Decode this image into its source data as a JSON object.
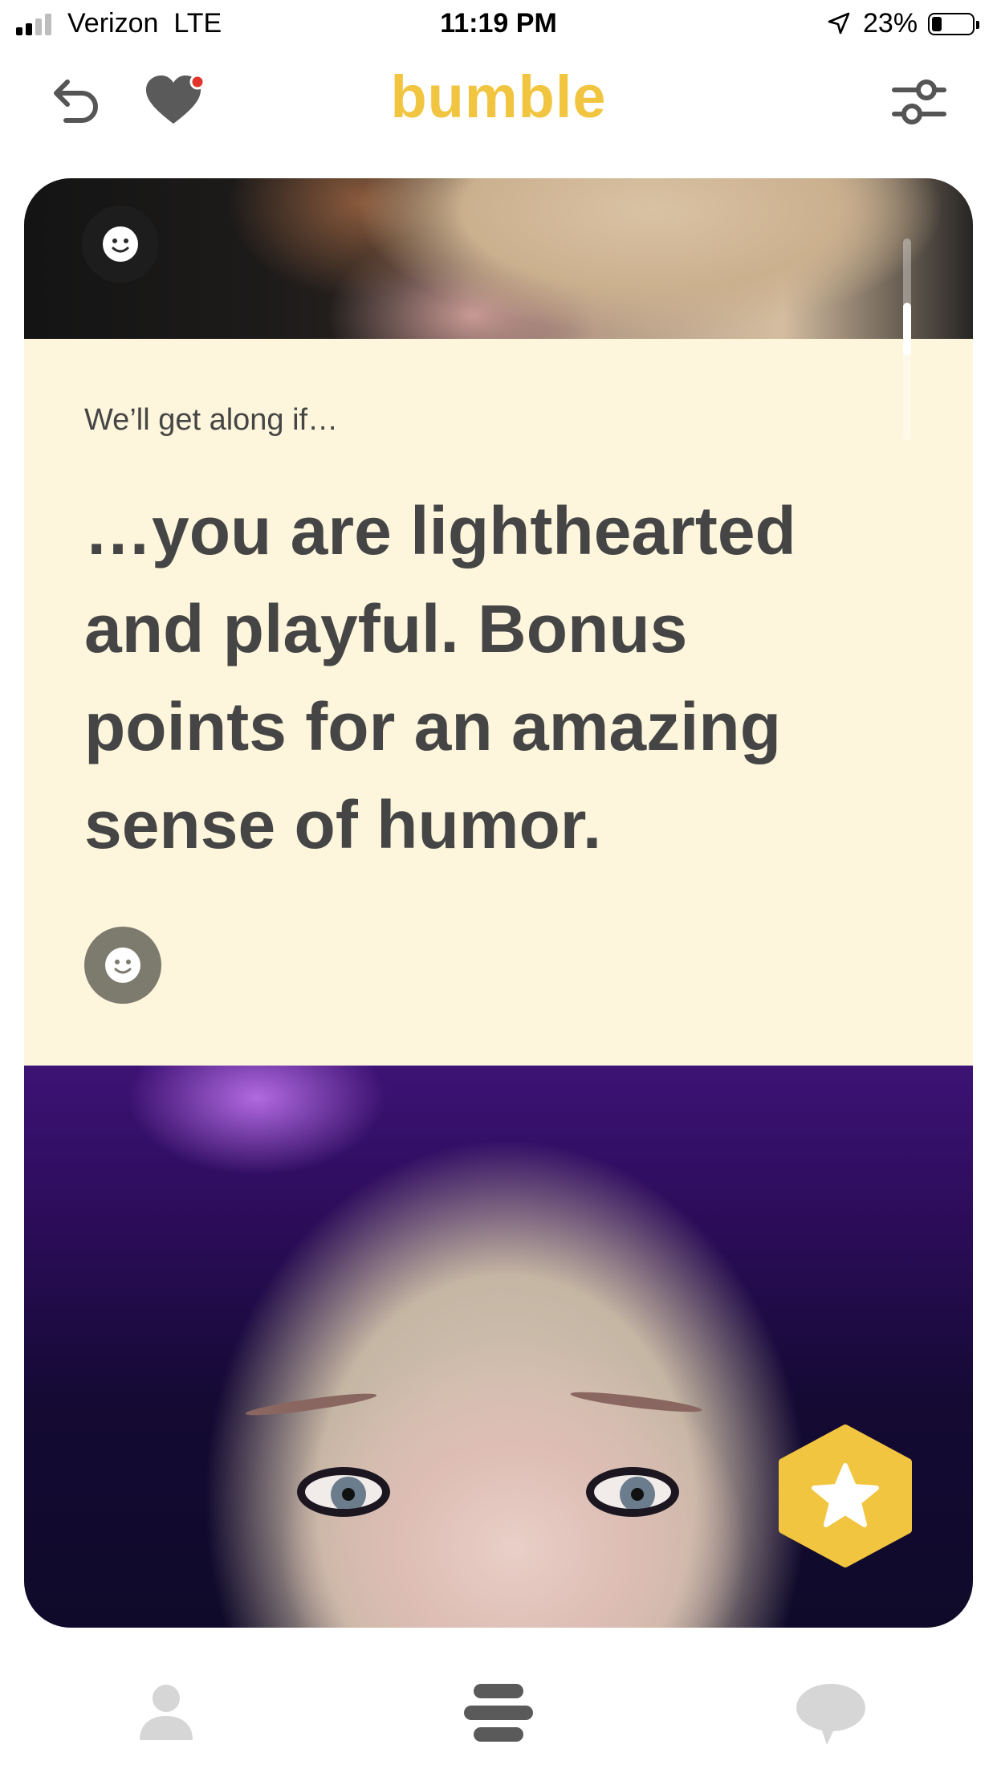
{
  "status_bar": {
    "carrier": "Verizon",
    "network": "LTE",
    "time": "11:19 PM",
    "battery": "23%"
  },
  "header": {
    "brand": "bumble",
    "back_icon": "undo-arrow-icon",
    "likes_icon": "heart-icon",
    "filter_icon": "sliders-icon"
  },
  "profile_card": {
    "prompt_label": "We’ll get along if…",
    "prompt_answer": "…you are lighthearted and playful. Bonus points for an amazing sense of humor.",
    "reaction_icon": "smiley-face-icon",
    "superswipe_icon": "star-hexagon-icon"
  },
  "bottom_nav": {
    "items": [
      "profile-icon",
      "people-stack-icon",
      "chat-bubble-icon"
    ]
  },
  "colors": {
    "brand": "#f1c540",
    "prompt_background": "#fdf5dc",
    "text": "#454545",
    "nav_inactive": "#d6d6d6",
    "nav_active": "#5a5a5a",
    "notification_dot": "#e0342c"
  }
}
